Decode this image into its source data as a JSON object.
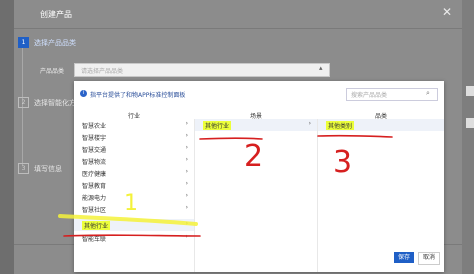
{
  "dialog": {
    "title": "创建产品",
    "close_icon": "close-icon",
    "steps": [
      {
        "num": "1",
        "label": "选择产品品类",
        "active": true
      },
      {
        "num": "2",
        "label": "选择智能化方",
        "active": false
      },
      {
        "num": "3",
        "label": "填写信息",
        "active": false
      }
    ],
    "field_label": "产品品类",
    "select_placeholder": "请选择产品品类",
    "save_label": "保存",
    "cancel_label": "取消"
  },
  "panel": {
    "info_text": "指平台提供了和物APP标准控制面板",
    "search_placeholder": "搜索产品品类",
    "columns": [
      "行业",
      "场景",
      "品类"
    ],
    "industries": [
      "智慧农业",
      "智慧楼宇",
      "智慧交通",
      "智慧物流",
      "医疗健康",
      "智慧教育",
      "能源电力",
      "智慧社区",
      "其他行业",
      "智能车联"
    ],
    "scenes": [
      "其他行业"
    ],
    "categories": [
      "其他类别"
    ]
  },
  "annotations": {
    "marks": [
      "1",
      "2",
      "3"
    ],
    "ink_color": "#d61f1f",
    "highlight_color": "#ecff3a"
  },
  "colors": {
    "primary": "#1f5fc6"
  }
}
